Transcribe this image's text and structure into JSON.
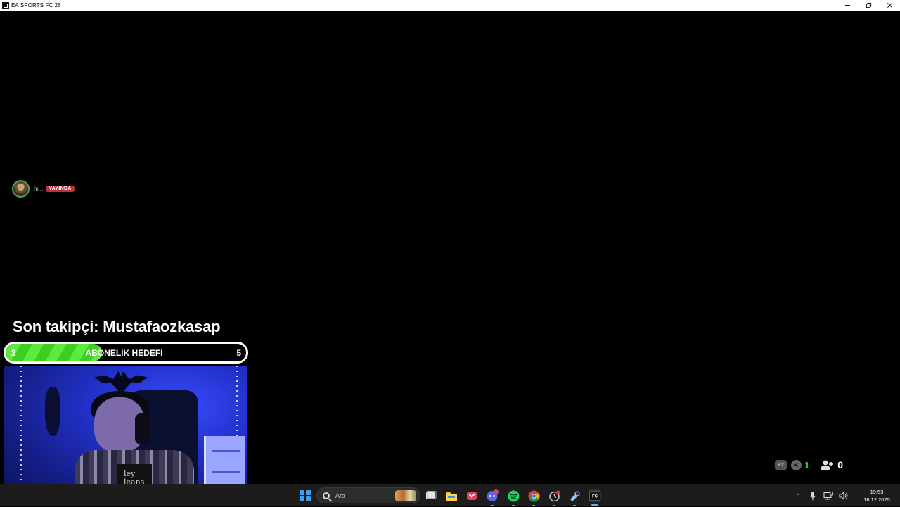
{
  "window": {
    "title": "EA SPORTS FC 26",
    "minimize_icon": "minimize-icon",
    "restore_icon": "restore-icon",
    "close_icon": "close-icon"
  },
  "discord_live": {
    "user": "m...",
    "badge": "YAYINDA"
  },
  "overlay": {
    "last_follower": "Son takipçi: Mustafaozkasap",
    "sub_goal": {
      "label": "ABONELİK HEDEFİ",
      "current": "2",
      "target": "5",
      "progress_fraction": 0.4,
      "fill_color": "#3ccf20"
    }
  },
  "stream_stats": {
    "badge": "R2",
    "audio_count": "1",
    "viewer_count": "0",
    "audio_color": "#3ccf3c"
  },
  "taskbar": {
    "search_placeholder": "Ara",
    "apps": [
      {
        "name": "task-view-icon"
      },
      {
        "name": "file-explorer-icon"
      },
      {
        "name": "pocket-icon"
      },
      {
        "name": "discord-icon",
        "badge": "9+"
      },
      {
        "name": "spotify-icon"
      },
      {
        "name": "chrome-icon"
      },
      {
        "name": "clock-app-icon"
      },
      {
        "name": "steam-icon"
      },
      {
        "name": "ea-app-icon"
      }
    ],
    "tray": {
      "time": "19:53",
      "date": "16.12.2025"
    }
  }
}
